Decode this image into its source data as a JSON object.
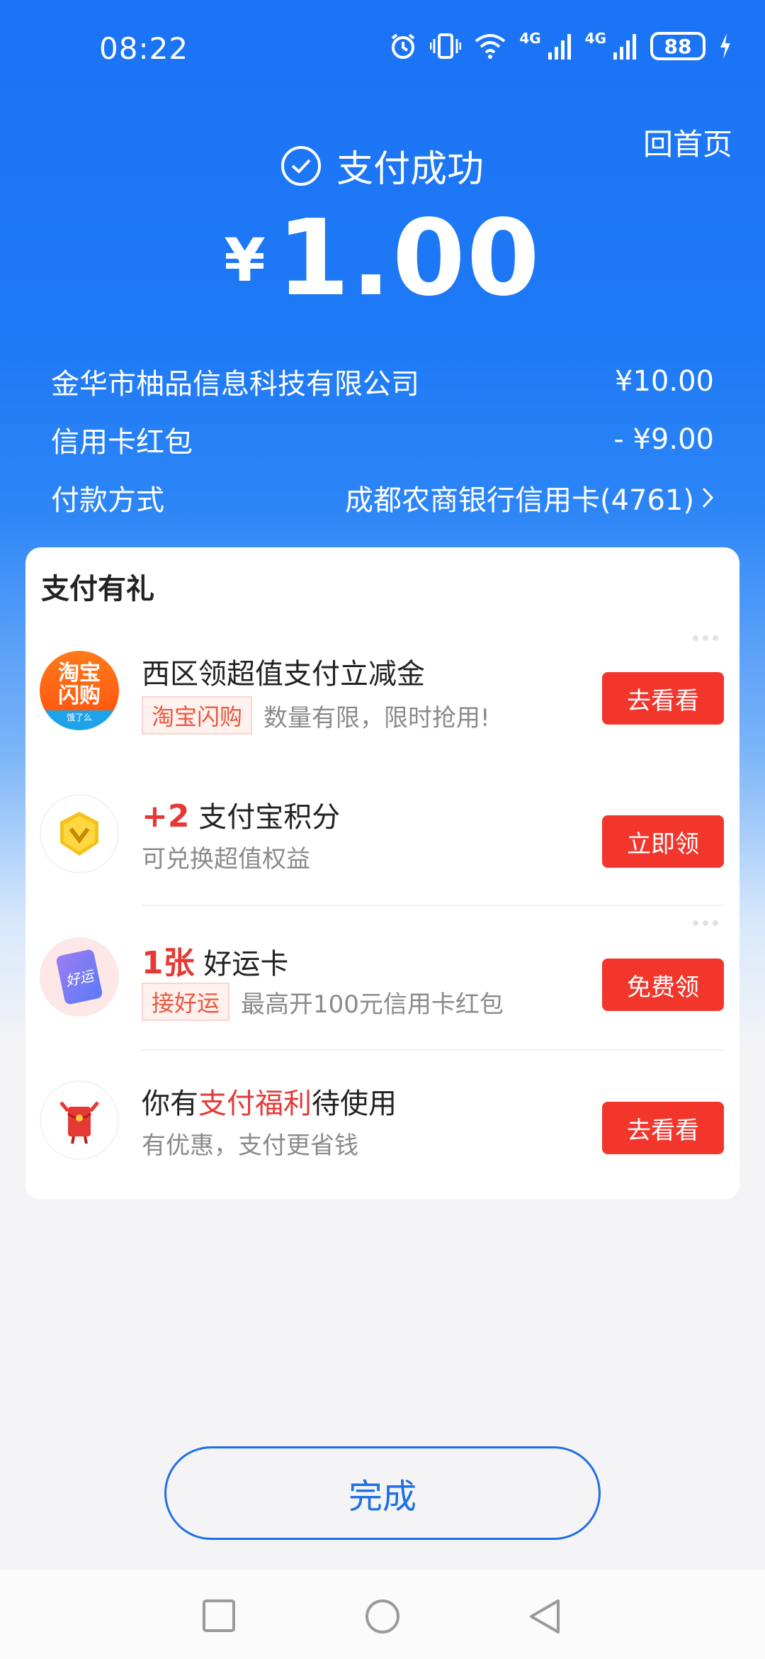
{
  "status_bar": {
    "time": "08:22",
    "battery": "88",
    "network1": "4G",
    "network2": "4G"
  },
  "header": {
    "home_label": "回首页",
    "success_label": "支付成功",
    "currency": "¥",
    "amount": "1.00"
  },
  "details": [
    {
      "label": "金华市柚品信息科技有限公司",
      "value": "¥10.00"
    },
    {
      "label": "信用卡红包",
      "value": "- ¥9.00"
    },
    {
      "label": "付款方式",
      "value": "成都农商银行信用卡(4761)"
    }
  ],
  "rewards": {
    "title": "支付有礼",
    "items": [
      {
        "logo_text_1": "淘宝",
        "logo_text_2": "闪购",
        "logo_text_3": "饿了么",
        "title": "西区领超值支付立减金",
        "tag": "淘宝闪购",
        "desc": "数量有限，限时抢用!",
        "button": "去看看"
      },
      {
        "title_highlight": "+2",
        "title": "支付宝积分",
        "desc": "可兑换超值权益",
        "button": "立即领"
      },
      {
        "logo_text": "好运",
        "title_highlight": "1张",
        "title": "好运卡",
        "tag": "接好运",
        "desc": "最高开100元信用卡红包",
        "button": "免费领"
      },
      {
        "title_pre": "你有",
        "title_highlight": "支付福利",
        "title_post": "待使用",
        "desc": "有优惠，支付更省钱",
        "button": "去看看"
      }
    ]
  },
  "done_button": "完成",
  "colors": {
    "primary_blue": "#1a73f5",
    "cta_red": "#f2362c",
    "highlight_red": "#e53935",
    "tag_orange": "#e9583f"
  },
  "nav_icons": [
    "recents-square-icon",
    "home-circle-icon",
    "back-triangle-icon"
  ]
}
